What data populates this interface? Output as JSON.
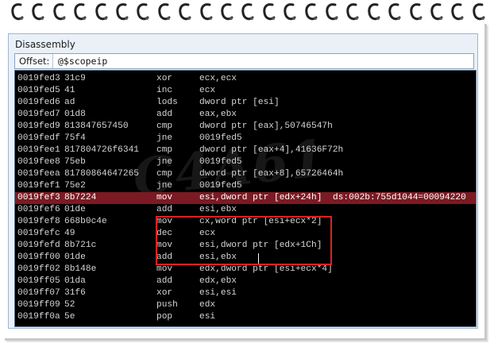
{
  "window": {
    "title": "Disassembly"
  },
  "offset": {
    "label": "Offset:",
    "value": "@$scopeip"
  },
  "watermark": "C4A61",
  "colors": {
    "highlight": "#7b1a22",
    "redbox": "#e02020",
    "background": "#000000"
  },
  "rows": [
    {
      "addr": "0019fed3",
      "bytes": "31c9",
      "mn": "xor",
      "ops": "ecx,ecx",
      "cmt": ""
    },
    {
      "addr": "0019fed5",
      "bytes": "41",
      "mn": "inc",
      "ops": "ecx",
      "cmt": ""
    },
    {
      "addr": "0019fed6",
      "bytes": "ad",
      "mn": "lods",
      "ops": "dword ptr [esi]",
      "cmt": ""
    },
    {
      "addr": "0019fed7",
      "bytes": "01d8",
      "mn": "add",
      "ops": "eax,ebx",
      "cmt": ""
    },
    {
      "addr": "0019fed9",
      "bytes": "813847657450",
      "mn": "cmp",
      "ops": "dword ptr [eax],50746547h",
      "cmt": ""
    },
    {
      "addr": "0019fedf",
      "bytes": "75f4",
      "mn": "jne",
      "ops": "0019fed5",
      "cmt": ""
    },
    {
      "addr": "0019fee1",
      "bytes": "817804726f6341",
      "mn": "cmp",
      "ops": "dword ptr [eax+4],41636F72h",
      "cmt": ""
    },
    {
      "addr": "0019fee8",
      "bytes": "75eb",
      "mn": "jne",
      "ops": "0019fed5",
      "cmt": ""
    },
    {
      "addr": "0019feea",
      "bytes": "81780864647265",
      "mn": "cmp",
      "ops": "dword ptr [eax+8],65726464h",
      "cmt": ""
    },
    {
      "addr": "0019fef1",
      "bytes": "75e2",
      "mn": "jne",
      "ops": "0019fed5",
      "cmt": ""
    },
    {
      "addr": "0019fef3",
      "bytes": "8b7224",
      "mn": "mov",
      "ops": "esi,dword ptr [edx+24h]",
      "cmt": "ds:002b:755d1044=00094220",
      "highlight": true
    },
    {
      "addr": "0019fef6",
      "bytes": "01de",
      "mn": "add",
      "ops": "esi,ebx",
      "cmt": ""
    },
    {
      "addr": "0019fef8",
      "bytes": "668b0c4e",
      "mn": "mov",
      "ops": "cx,word ptr [esi+ecx*2]",
      "cmt": ""
    },
    {
      "addr": "0019fefc",
      "bytes": "49",
      "mn": "dec",
      "ops": "ecx",
      "cmt": ""
    },
    {
      "addr": "0019fefd",
      "bytes": "8b721c",
      "mn": "mov",
      "ops": "esi,dword ptr [edx+1Ch]",
      "cmt": ""
    },
    {
      "addr": "0019ff00",
      "bytes": "01de",
      "mn": "add",
      "ops": "esi,ebx",
      "cmt": ""
    },
    {
      "addr": "0019ff02",
      "bytes": "8b148e",
      "mn": "mov",
      "ops": "edx,dword ptr [esi+ecx*4]",
      "cmt": ""
    },
    {
      "addr": "0019ff05",
      "bytes": "01da",
      "mn": "add",
      "ops": "edx,ebx",
      "cmt": ""
    },
    {
      "addr": "0019ff07",
      "bytes": "31f6",
      "mn": "xor",
      "ops": "esi,esi",
      "cmt": ""
    },
    {
      "addr": "0019ff09",
      "bytes": "52",
      "mn": "push",
      "ops": "edx",
      "cmt": ""
    },
    {
      "addr": "0019ff0a",
      "bytes": "5e",
      "mn": "pop",
      "ops": "esi",
      "cmt": ""
    }
  ]
}
